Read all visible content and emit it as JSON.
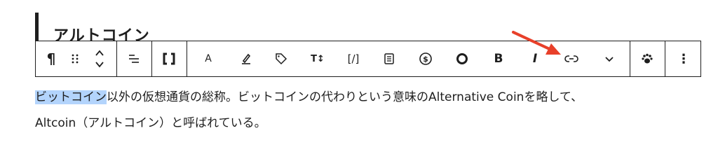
{
  "heading": {
    "text": "アルトコイン"
  },
  "toolbar": {
    "buttons": [
      {
        "name": "paragraph-button",
        "icon": "pilcrow-icon",
        "label": "¶"
      },
      {
        "name": "drag-handle",
        "icon": "drag-handle-icon",
        "label": ""
      },
      {
        "name": "move-up-down-buttons",
        "icon": "chevron-up-down-icon",
        "label": ""
      },
      {
        "name": "align-button",
        "icon": "align-right-icon",
        "label": ""
      },
      {
        "name": "brackets-button",
        "icon": "brackets-icon",
        "label": ""
      },
      {
        "name": "font-button",
        "icon": "font-icon",
        "label": "A"
      },
      {
        "name": "highlight-button",
        "icon": "highlighter-icon",
        "label": ""
      },
      {
        "name": "tag-button",
        "icon": "tag-icon",
        "label": ""
      },
      {
        "name": "font-size-button",
        "icon": "font-size-icon",
        "label": "T↕"
      },
      {
        "name": "shortcode-button",
        "icon": "bracket-slash-icon",
        "label": "[/]"
      },
      {
        "name": "document-button",
        "icon": "document-icon",
        "label": ""
      },
      {
        "name": "currency-button",
        "icon": "dollar-circle-icon",
        "label": "$"
      },
      {
        "name": "circle-button",
        "icon": "circle-icon",
        "label": ""
      },
      {
        "name": "bold-button",
        "icon": "bold-icon",
        "label": "B"
      },
      {
        "name": "italic-button",
        "icon": "italic-icon",
        "label": "I"
      },
      {
        "name": "link-button",
        "icon": "link-icon",
        "label": ""
      },
      {
        "name": "more-formats-button",
        "icon": "chevron-down-icon",
        "label": ""
      },
      {
        "name": "paw-button",
        "icon": "paw-icon",
        "label": ""
      },
      {
        "name": "options-button",
        "icon": "more-vertical-icon",
        "label": "⋮"
      }
    ]
  },
  "paragraph": {
    "selected": "ビットコイン",
    "rest_line1": "以外の仮想通貨の総称。ビットコインの代わりという意味のAlternative Coinを略して、",
    "line2": "Altcoin（アルトコイン）と呼ばれている。"
  },
  "annotation": {
    "arrow_color": "#e8402a",
    "icon": "arrow-icon"
  },
  "colors": {
    "selection": "#b3d4fc",
    "text": "#1e1e1e",
    "arrow": "#e8402a"
  }
}
